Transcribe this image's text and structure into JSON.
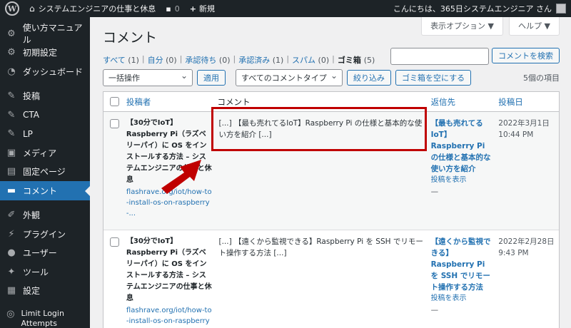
{
  "adminbar": {
    "site_name": "システムエンジニアの仕事と休息",
    "comments_count": "0",
    "new_label": "新規",
    "greeting": "こんにちは、365日システムエンジニア さん"
  },
  "sidebar": {
    "items": [
      {
        "label": "使い方マニュアル",
        "icon": "gear-icon"
      },
      {
        "label": "初期設定",
        "icon": "gear-icon"
      },
      {
        "label": "ダッシュボード",
        "icon": "dashboard-icon"
      },
      {
        "label": "投稿",
        "icon": "pin-icon"
      },
      {
        "label": "CTA",
        "icon": "pin-icon"
      },
      {
        "label": "LP",
        "icon": "pin-icon"
      },
      {
        "label": "メディア",
        "icon": "media-icon"
      },
      {
        "label": "固定ページ",
        "icon": "page-icon"
      },
      {
        "label": "コメント",
        "icon": "comment-icon"
      },
      {
        "label": "外観",
        "icon": "brush-icon"
      },
      {
        "label": "プラグイン",
        "icon": "plugin-icon"
      },
      {
        "label": "ユーザー",
        "icon": "user-icon"
      },
      {
        "label": "ツール",
        "icon": "wrench-icon"
      },
      {
        "label": "設定",
        "icon": "settings-icon"
      },
      {
        "label": "Limit Login Attempts",
        "icon": "lock-icon"
      }
    ]
  },
  "screen_options": {
    "options_label": "表示オプション ▼",
    "help_label": "ヘルプ ▼"
  },
  "page": {
    "title": "コメント"
  },
  "filters": {
    "all": "すべて",
    "all_count": "(1)",
    "mine": "自分",
    "mine_count": "(0)",
    "pending": "承認待ち",
    "pending_count": "(0)",
    "approved": "承認済み",
    "approved_count": "(1)",
    "spam": "スパム",
    "spam_count": "(0)",
    "trash": "ゴミ箱",
    "trash_count": "(5)"
  },
  "search": {
    "placeholder": "",
    "button": "コメントを検索"
  },
  "tablenav": {
    "bulk_action": "一括操作",
    "apply": "適用",
    "type_filter": "すべてのコメントタイプ",
    "filter_button": "絞り込み",
    "empty_trash": "ゴミ箱を空にする",
    "items_count": "5個の項目"
  },
  "table": {
    "headers": {
      "author": "投稿者",
      "comment": "コメント",
      "response": "返信先",
      "date": "投稿日"
    },
    "rows": [
      {
        "author": "【30分でIoT】Raspberry Pi（ラズベリーパイ）に OS をインストールする方法 – システムエンジニアの仕事と休息",
        "author_url": "flashrave.org/iot/how-to-install-os-on-raspberry-...",
        "comment": "[...] 【最も売れてるIoT】Raspberry Pi の仕様と基本的な使い方を紹介 [...]",
        "response_title": "【最も売れてるIoT】Raspberry Pi の仕様と基本的な使い方を紹介",
        "response_link": "投稿を表示",
        "response_dash": "—",
        "date": "2022年3月1日",
        "time": "10:44 PM"
      },
      {
        "author": "【30分でIoT】Raspberry Pi（ラズベリーパイ）に OS をインストールする方法 – システムエンジニアの仕事と休息",
        "author_url": "flashrave.org/iot/how-to-install-os-on-raspberry-...",
        "comment": "[...] 【遠くから監視できる】Raspberry Pi を SSH でリモート操作する方法 [...]",
        "response_title": "【遠くから監視できる】Raspberry Pi を SSH でリモート操作する方法",
        "response_link": "投稿を表示",
        "response_dash": "—",
        "date": "2022年2月28日",
        "time": "9:43 PM"
      }
    ]
  },
  "colors": {
    "accent": "#2271b1",
    "sidebar": "#1d2327",
    "highlight": "#c00000"
  }
}
